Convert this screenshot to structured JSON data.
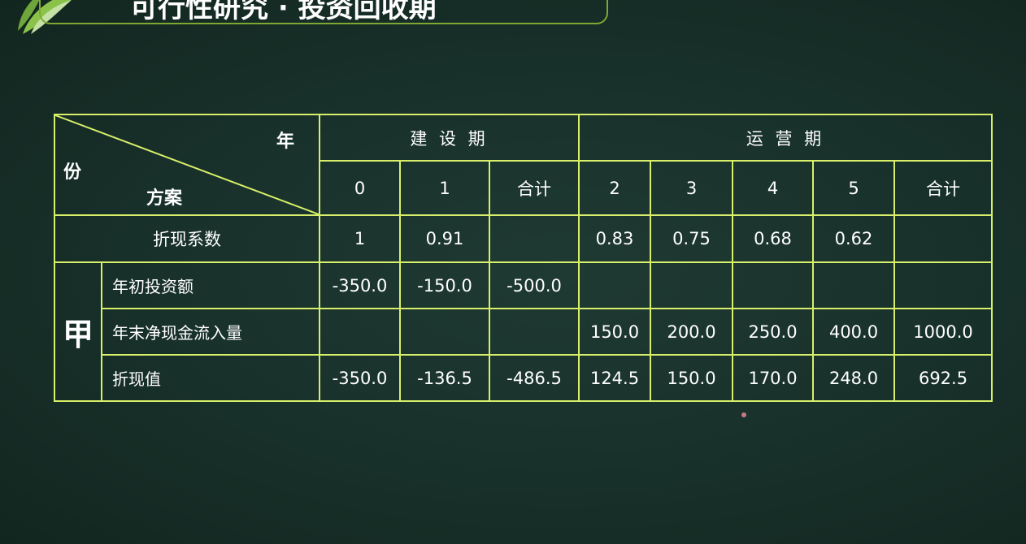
{
  "header": {
    "title": "可行性研究 · 投资回收期"
  },
  "table": {
    "corner": {
      "year": "年",
      "fen": "份",
      "plan": "方案"
    },
    "phases": {
      "construction": "建 设 期",
      "operation": "运 营 期"
    },
    "years": [
      "0",
      "1",
      "合计",
      "2",
      "3",
      "4",
      "5",
      "合计"
    ],
    "discount_label": "折现系数",
    "discount_values": [
      "1",
      "0.91",
      "",
      "0.83",
      "0.75",
      "0.68",
      "0.62",
      ""
    ],
    "group": "甲",
    "rows": [
      {
        "label": "年初投资额",
        "values": [
          "-350.0",
          "-150.0",
          "-500.0",
          "",
          "",
          "",
          "",
          ""
        ]
      },
      {
        "label": "年末净现金流入量",
        "values": [
          "",
          "",
          "",
          "150.0",
          "200.0",
          "250.0",
          "400.0",
          "1000.0"
        ]
      },
      {
        "label": "折现值",
        "values": [
          "-350.0",
          "-136.5",
          "-486.5",
          "124.5",
          "150.0",
          "170.0",
          "248.0",
          "692.5"
        ]
      }
    ]
  },
  "colors": {
    "board": "#18302a",
    "grid_line": "#d8ef6a",
    "text": "#ffffff"
  }
}
